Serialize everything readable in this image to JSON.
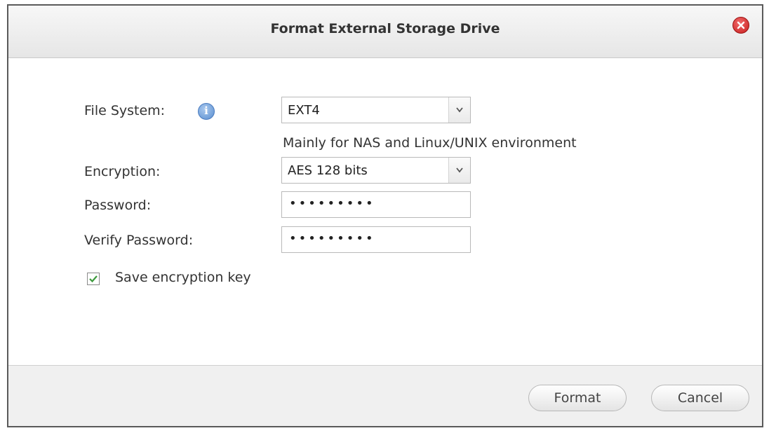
{
  "dialog": {
    "title": "Format External Storage Drive",
    "close_icon": "close-icon"
  },
  "form": {
    "file_system": {
      "label": "File System:",
      "info_icon": "info-icon",
      "info_glyph": "i",
      "selected": "EXT4",
      "hint": "Mainly for NAS and Linux/UNIX environment"
    },
    "encryption": {
      "label": "Encryption:",
      "selected": "AES 128 bits"
    },
    "password": {
      "label": "Password:",
      "value": "•••••••••"
    },
    "verify_password": {
      "label": "Verify Password:",
      "value": "•••••••••"
    },
    "save_key": {
      "label": "Save encryption key",
      "checked": true
    }
  },
  "footer": {
    "format_label": "Format",
    "cancel_label": "Cancel"
  },
  "colors": {
    "close": "#c81d1d",
    "info": "#5a8fd0",
    "check": "#3c9a3c"
  }
}
